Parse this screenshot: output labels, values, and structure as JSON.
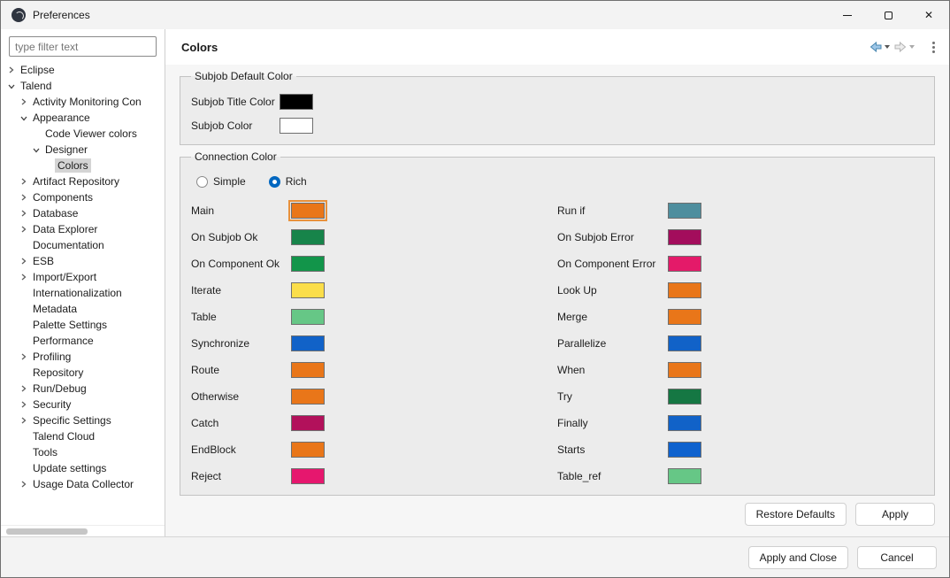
{
  "window": {
    "title": "Preferences"
  },
  "accent": "#0067c0",
  "sidebar": {
    "filter_placeholder": "type filter text",
    "tree": [
      {
        "label": "Eclipse",
        "level": 0,
        "arrow": "collapsed"
      },
      {
        "label": "Talend",
        "level": 0,
        "arrow": "expanded"
      },
      {
        "label": "Activity Monitoring Con",
        "level": 1,
        "arrow": "collapsed"
      },
      {
        "label": "Appearance",
        "level": 1,
        "arrow": "expanded"
      },
      {
        "label": "Code Viewer colors",
        "level": 2,
        "arrow": "none"
      },
      {
        "label": "Designer",
        "level": 2,
        "arrow": "expanded"
      },
      {
        "label": "Colors",
        "level": 3,
        "arrow": "none",
        "selected": true
      },
      {
        "label": "Artifact Repository",
        "level": 1,
        "arrow": "collapsed"
      },
      {
        "label": "Components",
        "level": 1,
        "arrow": "collapsed"
      },
      {
        "label": "Database",
        "level": 1,
        "arrow": "collapsed"
      },
      {
        "label": "Data Explorer",
        "level": 1,
        "arrow": "collapsed"
      },
      {
        "label": "Documentation",
        "level": 1,
        "arrow": "none"
      },
      {
        "label": "ESB",
        "level": 1,
        "arrow": "collapsed"
      },
      {
        "label": "Import/Export",
        "level": 1,
        "arrow": "collapsed"
      },
      {
        "label": "Internationalization",
        "level": 1,
        "arrow": "none"
      },
      {
        "label": "Metadata",
        "level": 1,
        "arrow": "none"
      },
      {
        "label": "Palette Settings",
        "level": 1,
        "arrow": "none"
      },
      {
        "label": "Performance",
        "level": 1,
        "arrow": "none"
      },
      {
        "label": "Profiling",
        "level": 1,
        "arrow": "collapsed"
      },
      {
        "label": "Repository",
        "level": 1,
        "arrow": "none"
      },
      {
        "label": "Run/Debug",
        "level": 1,
        "arrow": "collapsed"
      },
      {
        "label": "Security",
        "level": 1,
        "arrow": "collapsed"
      },
      {
        "label": "Specific Settings",
        "level": 1,
        "arrow": "collapsed"
      },
      {
        "label": "Talend Cloud",
        "level": 1,
        "arrow": "none"
      },
      {
        "label": "Tools",
        "level": 1,
        "arrow": "none"
      },
      {
        "label": "Update settings",
        "level": 1,
        "arrow": "none"
      },
      {
        "label": "Usage Data Collector",
        "level": 1,
        "arrow": "collapsed"
      }
    ]
  },
  "header": {
    "title": "Colors"
  },
  "subjob_group": {
    "title": "Subjob Default Color",
    "rows": [
      {
        "label": "Subjob Title Color",
        "color": "#000000"
      },
      {
        "label": "Subjob Color",
        "color": "#ffffff"
      }
    ]
  },
  "connection_group": {
    "title": "Connection Color",
    "radios": [
      {
        "label": "Simple",
        "checked": false
      },
      {
        "label": "Rich",
        "checked": true
      }
    ],
    "left": [
      {
        "label": "Main",
        "color": "#e97619",
        "focused": true
      },
      {
        "label": "On Subjob Ok",
        "color": "#17844a"
      },
      {
        "label": "On Component Ok",
        "color": "#12954a"
      },
      {
        "label": "Iterate",
        "color": "#fbde4a"
      },
      {
        "label": "Table",
        "color": "#66c786"
      },
      {
        "label": "Synchronize",
        "color": "#1162c8"
      },
      {
        "label": "Route",
        "color": "#e97619"
      },
      {
        "label": "Otherwise",
        "color": "#e97619"
      },
      {
        "label": "Catch",
        "color": "#b2115b"
      },
      {
        "label": "EndBlock",
        "color": "#e97619"
      },
      {
        "label": "Reject",
        "color": "#e6176e"
      }
    ],
    "right": [
      {
        "label": "Run if",
        "color": "#4e8e9e"
      },
      {
        "label": "On Subjob Error",
        "color": "#a30d5c"
      },
      {
        "label": "On Component Error",
        "color": "#e41a69"
      },
      {
        "label": "Look Up",
        "color": "#e97619"
      },
      {
        "label": "Merge",
        "color": "#e97619"
      },
      {
        "label": "Parallelize",
        "color": "#1162c8"
      },
      {
        "label": "When",
        "color": "#e97619"
      },
      {
        "label": "Try",
        "color": "#157743"
      },
      {
        "label": "Finally",
        "color": "#1162c8"
      },
      {
        "label": "Starts",
        "color": "#0f62ce"
      },
      {
        "label": "Table_ref",
        "color": "#66c786"
      }
    ]
  },
  "buttons": {
    "restore_defaults": "Restore Defaults",
    "apply": "Apply",
    "apply_and_close": "Apply and Close",
    "cancel": "Cancel"
  }
}
